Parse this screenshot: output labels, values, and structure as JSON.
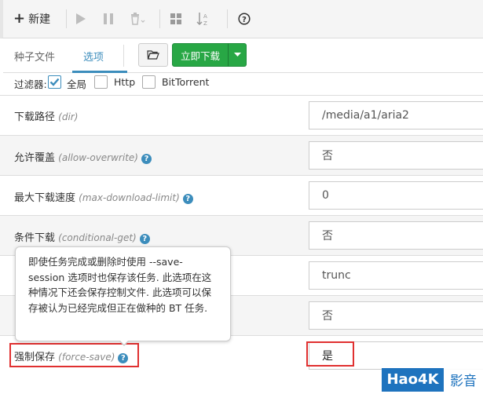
{
  "toolbar": {
    "new_label": "新建"
  },
  "tabs": {
    "torrent_files": "种子文件",
    "options": "选项",
    "download_now": "立即下载"
  },
  "filters": {
    "label": "过滤器:",
    "global": "全局",
    "http": "Http",
    "bittorrent": "BitTorrent",
    "global_checked": true
  },
  "options": [
    {
      "label": "下载路径",
      "key": "(dir)",
      "value": "/media/a1/aria2",
      "help": false
    },
    {
      "label": "允许覆盖",
      "key": "(allow-overwrite)",
      "value": "否",
      "help": true
    },
    {
      "label": "最大下载速度",
      "key": "(max-download-limit)",
      "value": "0",
      "help": true
    },
    {
      "label": "条件下载",
      "key": "(conditional-get)",
      "value": "否",
      "help": true
    },
    {
      "label": "",
      "key": "",
      "value": "trunc",
      "help": false
    },
    {
      "label": "",
      "key": "",
      "value": "否",
      "help": false
    },
    {
      "label": "强制保存",
      "key": "(force-save)",
      "value": "是",
      "help": true
    }
  ],
  "tooltip": {
    "text": "即使任务完成或删除时使用 --save-session 选项时也保存该任务. 此选项在这种情况下还会保存控制文件. 此选项可以保存被认为已经完成但正在做种的 BT 任务."
  },
  "watermark": {
    "brand": "Hao4K",
    "suffix": "影音"
  },
  "colors": {
    "accent": "#3c8dbc",
    "download_button": "#28a745",
    "highlight": "#e03030"
  }
}
